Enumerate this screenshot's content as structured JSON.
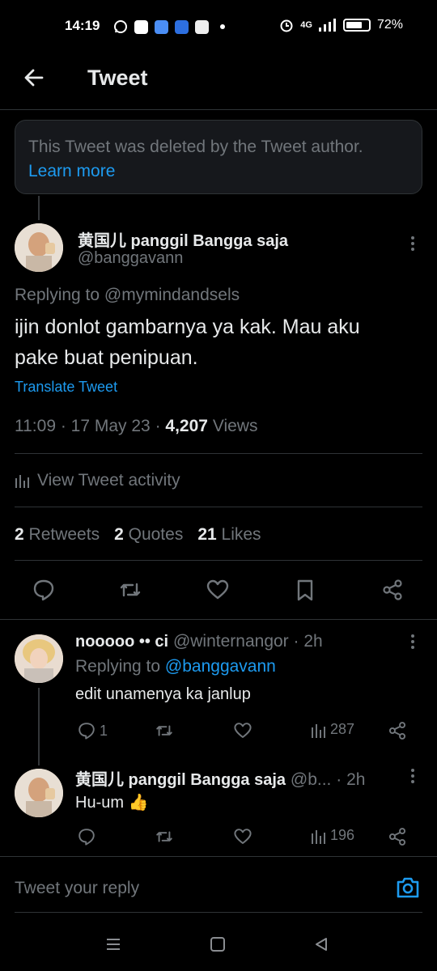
{
  "status_bar": {
    "time": "14:19",
    "network": "4G",
    "battery": "72%"
  },
  "header": {
    "title": "Tweet"
  },
  "deleted_notice": {
    "text": "This Tweet was deleted by the Tweet author.",
    "link": "Learn more"
  },
  "main_tweet": {
    "author_name": "黄国儿 panggil Bangga saja",
    "author_handle": "@banggavann",
    "replying_prefix": "Replying to",
    "replying_to": "@mymindandsels",
    "text_line1": "ijin donlot gambarnya ya kak. Mau aku",
    "text_line2": "pake buat penipuan.",
    "translate": "Translate Tweet",
    "time": "11:09",
    "date": "17 May 23",
    "views_count": "4,207",
    "views_label": "Views",
    "activity": "View Tweet activity",
    "retweets_count": "2",
    "retweets_label": "Retweets",
    "quotes_count": "2",
    "quotes_label": "Quotes",
    "likes_count": "21",
    "likes_label": "Likes"
  },
  "replies": [
    {
      "name": "nooooo •• ci",
      "handle": "@winternangor",
      "age": "· 2h",
      "replying_prefix": "Replying to",
      "replying_to": "@banggavann",
      "text": "edit unamenya ka janlup",
      "reply_count": "1",
      "views": "287"
    },
    {
      "name": "黄国儿 panggil Bangga saja",
      "handle": "@b...",
      "age": "· 2h",
      "text": "Hu-um 👍",
      "views": "196"
    }
  ],
  "composer": {
    "placeholder": "Tweet your reply"
  },
  "colors": {
    "background": "#000000",
    "accent": "#1d9bf0",
    "secondary_text": "#71767b",
    "divider": "#2f3336"
  }
}
